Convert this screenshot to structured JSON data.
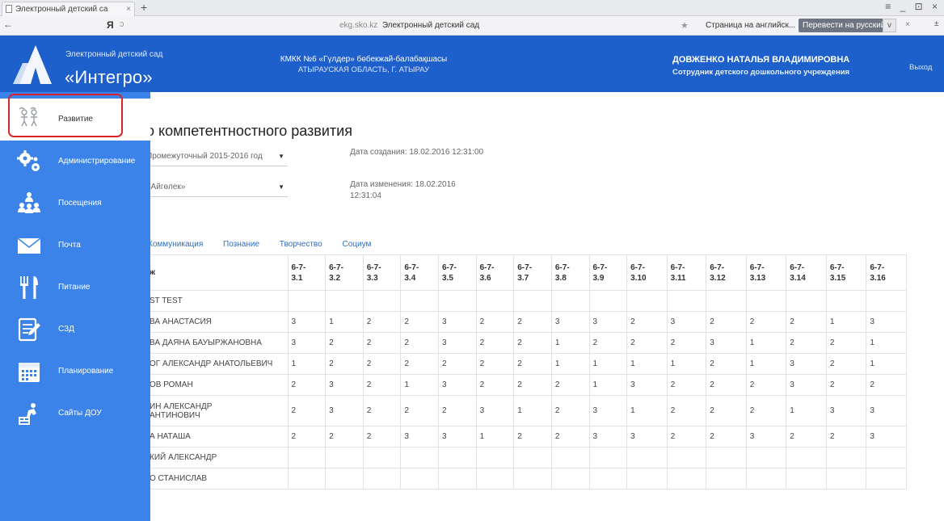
{
  "browser": {
    "tab_title": "Электронный детский са",
    "tab_close": "×",
    "new_tab": "+",
    "window_controls": "≡ _ ⊡ ×",
    "back": "←",
    "yandex": "Я",
    "reload": "ↄ",
    "url_domain": "ekg.sko.kz",
    "url_title": "Электронный детский сад",
    "star": "★",
    "translate_prompt": "Страница на английск...",
    "translate_button": "Перевести на русский",
    "translate_dropdown": "v",
    "translate_close": "×",
    "extra": "±"
  },
  "header": {
    "app_small": "Электронный детский сад",
    "app_big": "«Интегро»",
    "org_line1": "КМКК №6 «Гүлдер» бөбекжай-балабақшасы",
    "org_line2": "АТЫРАУСКАЯ ОБЛАСТЬ, Г. АТЫРАУ",
    "user_name": "ДОВЖЕНКО НАТАЛЬЯ ВЛАДИМИРОВНА",
    "user_role": "Сотрудник детского дошкольного учреждения",
    "logout": "Выход"
  },
  "sidebar": {
    "items": [
      {
        "label": "Развитие",
        "icon": "development-icon"
      },
      {
        "label": "Администрирование",
        "icon": "gears-icon"
      },
      {
        "label": "Посещения",
        "icon": "people-icon"
      },
      {
        "label": "Почта",
        "icon": "mail-icon"
      },
      {
        "label": "Питание",
        "icon": "cutlery-icon"
      },
      {
        "label": "СЗД",
        "icon": "document-icon"
      },
      {
        "label": "Планирование",
        "icon": "calendar-icon"
      },
      {
        "label": "Сайты ДОУ",
        "icon": "site-icon"
      }
    ],
    "highlight_color": "#d9232d"
  },
  "main": {
    "title": "о компетентностного развития",
    "period_select": "Промежуточный 2015-2016 год",
    "group_select": "«Айгөлек»",
    "created": "Дата создания: 18.02.2016 12:31:00",
    "modified_line1": "Дата изменения: 18.02.2016",
    "modified_line2": "12:31:04",
    "tabs": [
      "Коммуникация",
      "Познание",
      "Творчество",
      "Социум"
    ]
  },
  "table": {
    "first_header": "ж",
    "columns": [
      "6-7-\n3.1",
      "6-7-\n3.2",
      "6-7-\n3.3",
      "6-7-\n3.4",
      "6-7-\n3.5",
      "6-7-\n3.6",
      "6-7-\n3.7",
      "6-7-\n3.8",
      "6-7-\n3.9",
      "6-7-\n3.10",
      "6-7-\n3.11",
      "6-7-\n3.12",
      "6-7-\n3.13",
      "6-7-\n3.14",
      "6-7-\n3.15",
      "6-7-\n3.16"
    ],
    "rows": [
      {
        "name": "ST TEST",
        "values": [
          "",
          "",
          "",
          "",
          "",
          "",
          "",
          "",
          "",
          "",
          "",
          "",
          "",
          "",
          "",
          ""
        ]
      },
      {
        "name": "ВА АНАСТАСИЯ",
        "values": [
          "3",
          "1",
          "2",
          "2",
          "3",
          "2",
          "2",
          "3",
          "3",
          "2",
          "3",
          "2",
          "2",
          "2",
          "1",
          "3"
        ]
      },
      {
        "name": "ВА ДАЯНА БАУЫРЖАНОВНА",
        "values": [
          "3",
          "2",
          "2",
          "2",
          "3",
          "2",
          "2",
          "1",
          "2",
          "2",
          "2",
          "3",
          "1",
          "2",
          "2",
          "1"
        ]
      },
      {
        "name": "ОГ АЛЕКСАНДР АНАТОЛЬЕВИЧ",
        "values": [
          "1",
          "2",
          "2",
          "2",
          "2",
          "2",
          "2",
          "1",
          "1",
          "1",
          "1",
          "2",
          "1",
          "3",
          "2",
          "1"
        ]
      },
      {
        "name": "ОВ РОМАН",
        "values": [
          "2",
          "3",
          "2",
          "1",
          "3",
          "2",
          "2",
          "2",
          "1",
          "3",
          "2",
          "2",
          "2",
          "3",
          "2",
          "2"
        ]
      },
      {
        "name": "ИН АЛЕКСАНДР\nАНТИНОВИЧ",
        "values": [
          "2",
          "3",
          "2",
          "2",
          "2",
          "3",
          "1",
          "2",
          "3",
          "1",
          "2",
          "2",
          "2",
          "1",
          "3",
          "3"
        ]
      },
      {
        "name": "А НАТАША",
        "values": [
          "2",
          "2",
          "2",
          "3",
          "3",
          "1",
          "2",
          "2",
          "3",
          "3",
          "2",
          "2",
          "3",
          "2",
          "2",
          "3"
        ]
      },
      {
        "name": "КИЙ АЛЕКСАНДР",
        "values": [
          "",
          "",
          "",
          "",
          "",
          "",
          "",
          "",
          "",
          "",
          "",
          "",
          "",
          "",
          "",
          ""
        ]
      },
      {
        "name": "О СТАНИСЛАВ",
        "values": [
          "",
          "",
          "",
          "",
          "",
          "",
          "",
          "",
          "",
          "",
          "",
          "",
          "",
          "",
          "",
          ""
        ]
      }
    ]
  }
}
